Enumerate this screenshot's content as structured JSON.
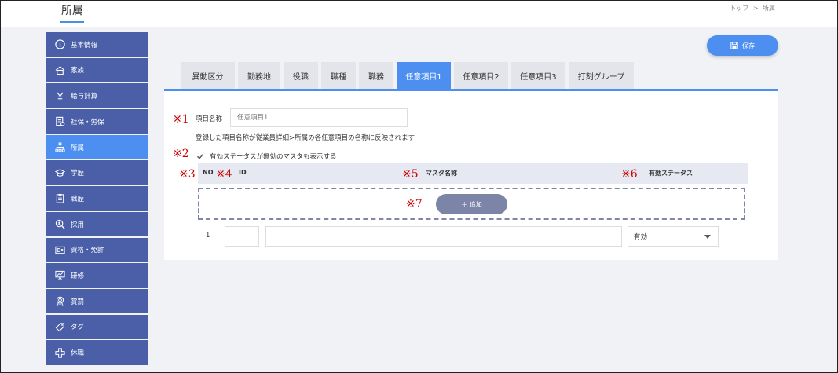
{
  "header": {
    "title": "所属",
    "breadcrumb": [
      "トップ",
      ">",
      "所属"
    ]
  },
  "sidebar": {
    "items": [
      {
        "label": "基本情報",
        "icon": "info-icon"
      },
      {
        "label": "家族",
        "icon": "house-icon"
      },
      {
        "label": "給与計算",
        "icon": "yen-icon"
      },
      {
        "label": "社保・労保",
        "icon": "document-icon"
      },
      {
        "label": "所属",
        "icon": "org-chart-icon",
        "active": true
      },
      {
        "label": "学歴",
        "icon": "graduation-cap-icon"
      },
      {
        "label": "職歴",
        "icon": "clipboard-icon"
      },
      {
        "label": "採用",
        "icon": "search-user-icon"
      },
      {
        "label": "資格・免許",
        "icon": "certificate-icon"
      },
      {
        "label": "研修",
        "icon": "presentation-icon"
      },
      {
        "label": "賞罰",
        "icon": "medal-icon"
      },
      {
        "label": "タグ",
        "icon": "tag-icon"
      },
      {
        "label": "休職",
        "icon": "cross-icon"
      }
    ]
  },
  "toolbar": {
    "save_label": "保存"
  },
  "tabs": [
    {
      "label": "異動区分"
    },
    {
      "label": "勤務地"
    },
    {
      "label": "役職"
    },
    {
      "label": "職種"
    },
    {
      "label": "職務"
    },
    {
      "label": "任意項目1",
      "active": true
    },
    {
      "label": "任意項目2"
    },
    {
      "label": "任意項目3"
    },
    {
      "label": "打刻グループ"
    }
  ],
  "form": {
    "item_name_label": "項目名称",
    "item_name_value": "任意項目1",
    "hint": "登録した項目名称が従業員詳細>所属の各任意項目の名称に反映されます",
    "show_inactive_label": "有効ステータスが無効のマスタも表示する",
    "show_inactive_checked": true
  },
  "table": {
    "headers": {
      "no": "NO",
      "id": "ID",
      "master_name": "マスタ名称",
      "status": "有効ステータス"
    },
    "add_label": "＋ 追加",
    "rows": [
      {
        "no": "1",
        "id": "",
        "name": "",
        "status": "有効"
      }
    ]
  },
  "markers": [
    "※1",
    "※2",
    "※3",
    "※4",
    "※5",
    "※6",
    "※7"
  ],
  "colors": {
    "sidebar": "#4a5fa8",
    "accent": "#4d8ff0",
    "marker": "#cc0000"
  }
}
